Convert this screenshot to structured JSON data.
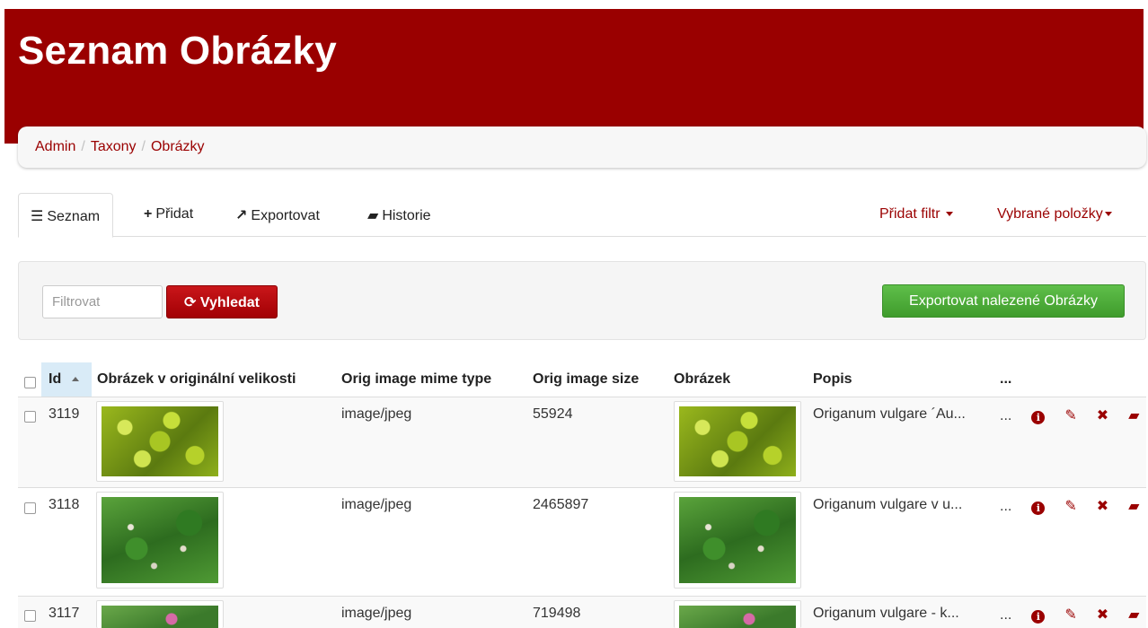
{
  "page": {
    "title": "Seznam Obrázky"
  },
  "breadcrumb": {
    "items": [
      "Admin",
      "Taxony",
      "Obrázky"
    ]
  },
  "tabs": {
    "list": "Seznam",
    "add": "Přidat",
    "export": "Exportovat",
    "history": "Historie",
    "add_filter": "Přidat filtr",
    "selected_items": "Vybrané položky"
  },
  "filter": {
    "placeholder": "Filtrovat",
    "search_label": "Vyhledat",
    "export_found_label": "Exportovat nalezené Obrázky"
  },
  "table": {
    "columns": [
      "Id",
      "Obrázek v originální velikosti",
      "Orig image mime type",
      "Orig image size",
      "Obrázek",
      "Popis",
      "..."
    ],
    "rows": [
      {
        "id": "3119",
        "mime": "image/jpeg",
        "size": "55924",
        "popis": "Origanum vulgare ´Au...",
        "more": "..."
      },
      {
        "id": "3118",
        "mime": "image/jpeg",
        "size": "2465897",
        "popis": "Origanum vulgare v u...",
        "more": "..."
      },
      {
        "id": "3117",
        "mime": "image/jpeg",
        "size": "719498",
        "popis": "Origanum vulgare - k...",
        "more": "..."
      }
    ]
  },
  "colors": {
    "brand": "#9a0000",
    "success": "#46a634"
  },
  "icons": [
    "list-icon",
    "plus-icon",
    "share-icon",
    "book-icon",
    "refresh-icon",
    "info-icon",
    "pencil-icon",
    "delete-icon",
    "history-icon"
  ]
}
